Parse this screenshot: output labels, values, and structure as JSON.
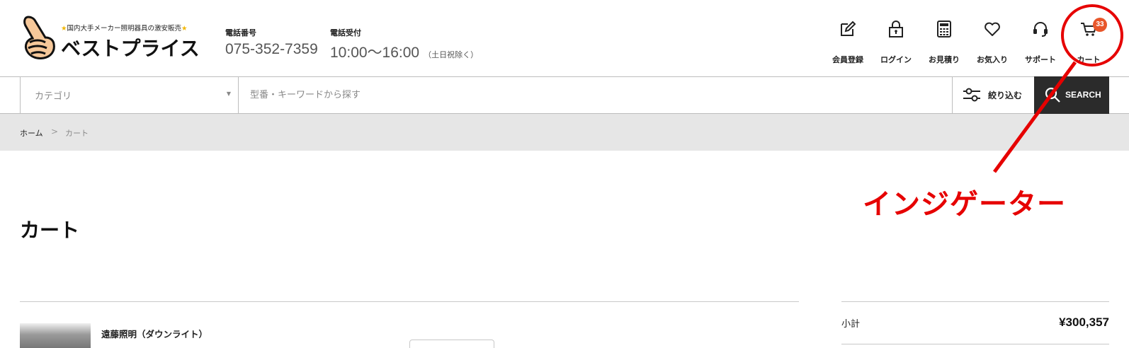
{
  "header": {
    "logo_tagline": "国内大手メーカー照明器具の激安販売",
    "logo_name": "ベストプライス",
    "phone_label": "電話番号",
    "phone_number": "075-352-7359",
    "hours_label": "電話受付",
    "hours_value": "10:00〜16:00",
    "hours_note": "（土日祝除く）",
    "nav": [
      {
        "label": "会員登録",
        "icon": "edit-icon"
      },
      {
        "label": "ログイン",
        "icon": "lock-icon"
      },
      {
        "label": "お見積り",
        "icon": "calculator-icon"
      },
      {
        "label": "お気入り",
        "icon": "heart-icon"
      },
      {
        "label": "サポート",
        "icon": "headset-icon"
      },
      {
        "label": "カート",
        "icon": "cart-icon",
        "badge": "33"
      }
    ]
  },
  "search": {
    "category_placeholder": "カテゴリ",
    "keyword_placeholder": "型番・キーワードから探す",
    "filter_label": "絞り込む",
    "search_label": "SEARCH"
  },
  "breadcrumb": {
    "home": "ホーム",
    "separator": ">",
    "current": "カート"
  },
  "main": {
    "title": "カート",
    "item": {
      "name": "遠藤照明（ダウンライト）"
    }
  },
  "summary": {
    "subtotal_label": "小計",
    "subtotal_value": "¥300,357"
  },
  "annotation": {
    "label": "インジゲーター",
    "color": "#e60000"
  },
  "colors": {
    "badge": "#e8562a",
    "search_button": "#2b2b2b",
    "breadcrumb_bg": "#e6e6e6",
    "annotation": "#e60000"
  }
}
